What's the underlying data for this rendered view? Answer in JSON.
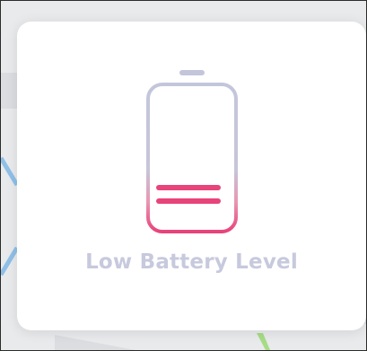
{
  "dialog": {
    "title": "Low Battery Level",
    "icon": "low-battery-icon"
  },
  "colors": {
    "icon_top": "#c3c6db",
    "icon_bottom": "#e8437a",
    "title": "#c7c9dd",
    "card": "#ffffff",
    "map_water": "#8fc0e8",
    "map_park": "#a6dc86",
    "map_bg": "#e9eaec"
  }
}
